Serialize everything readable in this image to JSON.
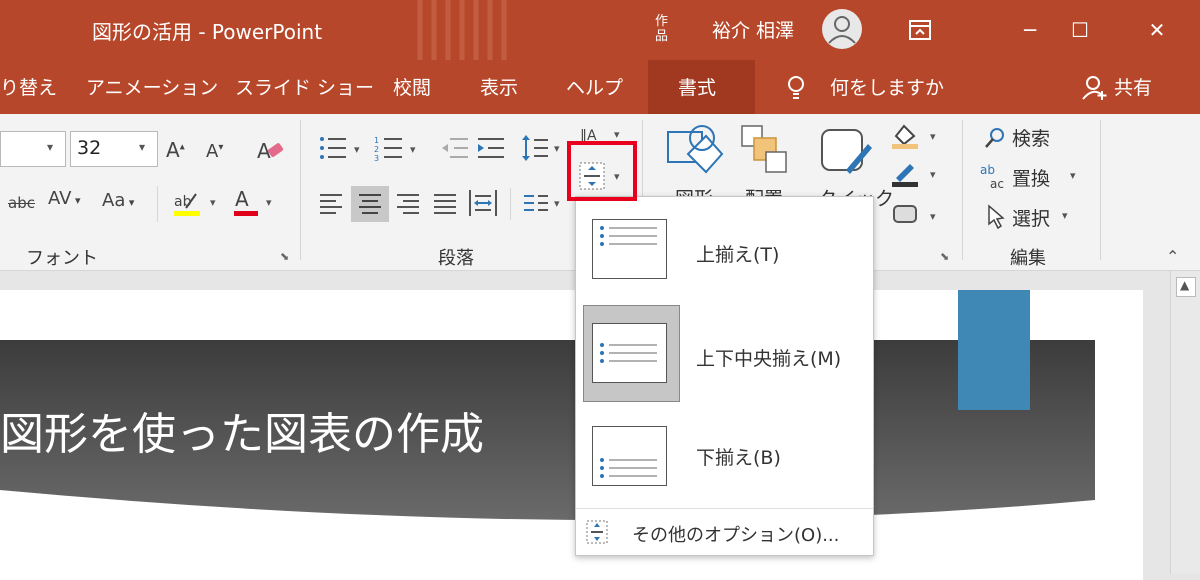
{
  "titlebar": {
    "title": "図形の活用 - PowerPoint",
    "user_name": "裕介 相澤",
    "ribbon_display_icon": "ribbon-display-options-icon",
    "minimize": "─",
    "maximize": "☐",
    "close": "✕"
  },
  "tabs": {
    "cut_prefix": "り替え",
    "animation": "アニメーション",
    "slideshow": "スライド ショー",
    "review": "校閲",
    "view": "表示",
    "help": "ヘルプ",
    "format": "書式",
    "tell_me": "何をしますか",
    "share": "共有"
  },
  "ribbon": {
    "font_size": "32",
    "font_group_label": "フォント",
    "paragraph_group_label": "段落",
    "editing_group_label": "編集",
    "shape_label_cut": "図形",
    "arrange_label_cut": "配置",
    "quick_label_cut": "クイック",
    "search_label": "検索",
    "replace_label": "置換",
    "select_label": "選択"
  },
  "slide": {
    "title": "図形を使った図表の作成"
  },
  "menu": {
    "items": [
      {
        "label": "上揃え(T)"
      },
      {
        "label": "上下中央揃え(M)"
      },
      {
        "label": "下揃え(B)"
      }
    ],
    "more_options": "その他のオプション(O)..."
  },
  "colors": {
    "accent": "#b7472a",
    "highlight": "#e8001c",
    "slide_blue": "#3f87b5"
  }
}
